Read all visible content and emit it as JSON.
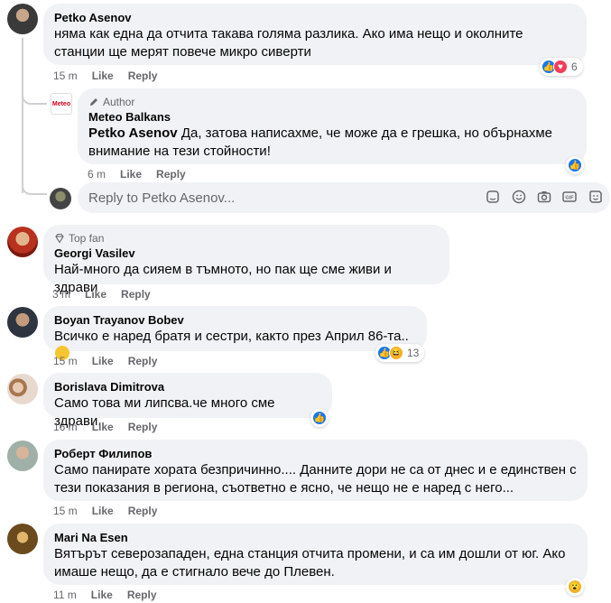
{
  "comments": [
    {
      "author": "Petko Asenov",
      "text": "няма как една да отчита такава голяма разлика. Ако има нещо и околните станции ще мерят повече микро сиверти",
      "time": "15 m",
      "like": "Like",
      "reply": "Reply",
      "reactions": "6"
    },
    {
      "badge": "Author",
      "author": "Meteo Balkans",
      "mention": "Petko Asenov",
      "text": " Да, затова написахме, че може да е грешка, но обърнахме внимание на тези стойности!",
      "time": "6 m",
      "like": "Like",
      "reply": "Reply",
      "logo_text": "Meteo"
    },
    {
      "badge": "Top fan",
      "author": "Georgi Vasilev",
      "text": "Най-много да сияем в тъмното, но пак ще сме живи и здрави",
      "time": "3 m",
      "like": "Like",
      "reply": "Reply"
    },
    {
      "author": "Boyan Trayanov Bobev",
      "text": "Всичко е наред братя и сестри, както през Април 86-та..",
      "time": "15 m",
      "like": "Like",
      "reply": "Reply",
      "reactions": "13"
    },
    {
      "author": "Borislava Dimitrova",
      "text": "Само това ми липсва.че много сме здрави.",
      "time": "16 m",
      "like": "Like",
      "reply": "Reply"
    },
    {
      "author": "Роберт Филипов",
      "text": "Само панирате хората безпричинно.... Данните дори не са от днес и е единствен с тези показания в региона, съответно е ясно, че нещо не е наред с него...",
      "time": "15 m",
      "like": "Like",
      "reply": "Reply"
    },
    {
      "author": "Mari Na Esen",
      "text": "Вятърът северозападен, една станция отчита промени, и са им дошли от юг. Ако имаше нещо, да е стигнало вече до Плевен.",
      "time": "11 m",
      "like": "Like",
      "reply": "Reply"
    }
  ],
  "reply_box": {
    "placeholder": "Reply to Petko Asenov..."
  },
  "icons": {
    "react_like": "like-icon",
    "react_love": "love-icon",
    "react_haha": "haha-icon",
    "react_wow": "wow-icon",
    "toolbar": [
      "sticker-icon",
      "emoji-icon",
      "camera-icon",
      "gif-icon",
      "avatar-sticker-icon"
    ]
  },
  "colors": {
    "bubble": "#f0f2f5",
    "meta": "#65676b",
    "like_blue": "#1877f2",
    "love_red": "#f33e58"
  }
}
